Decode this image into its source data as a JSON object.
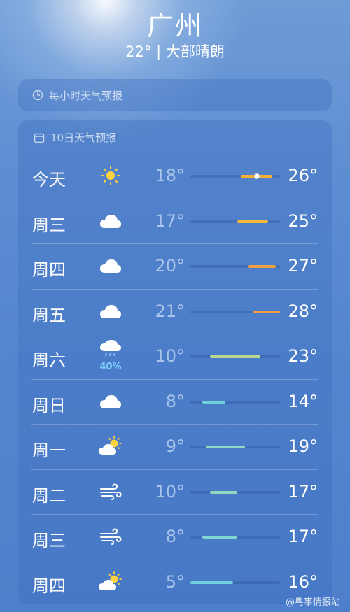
{
  "header": {
    "city": "广州",
    "subtitle": "22° | 大部晴朗"
  },
  "hourly": {
    "title": "每小时天气预报"
  },
  "daily": {
    "title": "10日天气预报",
    "scale": {
      "min": 5,
      "max": 28
    },
    "days": [
      {
        "day": "今天",
        "icon": "sun-icon",
        "low": "18°",
        "high": "26°",
        "lo": 18,
        "hi": 26,
        "now": 22,
        "color": "#f2b134"
      },
      {
        "day": "周三",
        "icon": "cloud-icon",
        "low": "17°",
        "high": "25°",
        "lo": 17,
        "hi": 25,
        "color": "#f5b83a"
      },
      {
        "day": "周四",
        "icon": "cloud-icon",
        "low": "20°",
        "high": "27°",
        "lo": 20,
        "hi": 27,
        "color": "#f0a040"
      },
      {
        "day": "周五",
        "icon": "cloud-icon",
        "low": "21°",
        "high": "28°",
        "lo": 21,
        "hi": 28,
        "color": "#ee9a40"
      },
      {
        "day": "周六",
        "icon": "rain-cloud-icon",
        "precip": "40%",
        "low": "10°",
        "high": "23°",
        "lo": 10,
        "hi": 23,
        "color": "#b9d690"
      },
      {
        "day": "周日",
        "icon": "cloud-icon",
        "low": "8°",
        "high": "14°",
        "lo": 8,
        "hi": 14,
        "color": "#6fd0d8"
      },
      {
        "day": "周一",
        "icon": "partly-sunny-icon",
        "low": "9°",
        "high": "19°",
        "lo": 9,
        "hi": 19,
        "color": "#8fd8c0"
      },
      {
        "day": "周二",
        "icon": "wind-icon",
        "low": "10°",
        "high": "17°",
        "lo": 10,
        "hi": 17,
        "color": "#8fd8c0"
      },
      {
        "day": "周三",
        "icon": "wind-icon",
        "low": "8°",
        "high": "17°",
        "lo": 8,
        "hi": 17,
        "color": "#7fd6d4"
      },
      {
        "day": "周四",
        "icon": "partly-sunny-icon",
        "low": "5°",
        "high": "16°",
        "lo": 5,
        "hi": 16,
        "color": "#6fd0e0"
      }
    ]
  },
  "watermark": "@粤事情报站"
}
